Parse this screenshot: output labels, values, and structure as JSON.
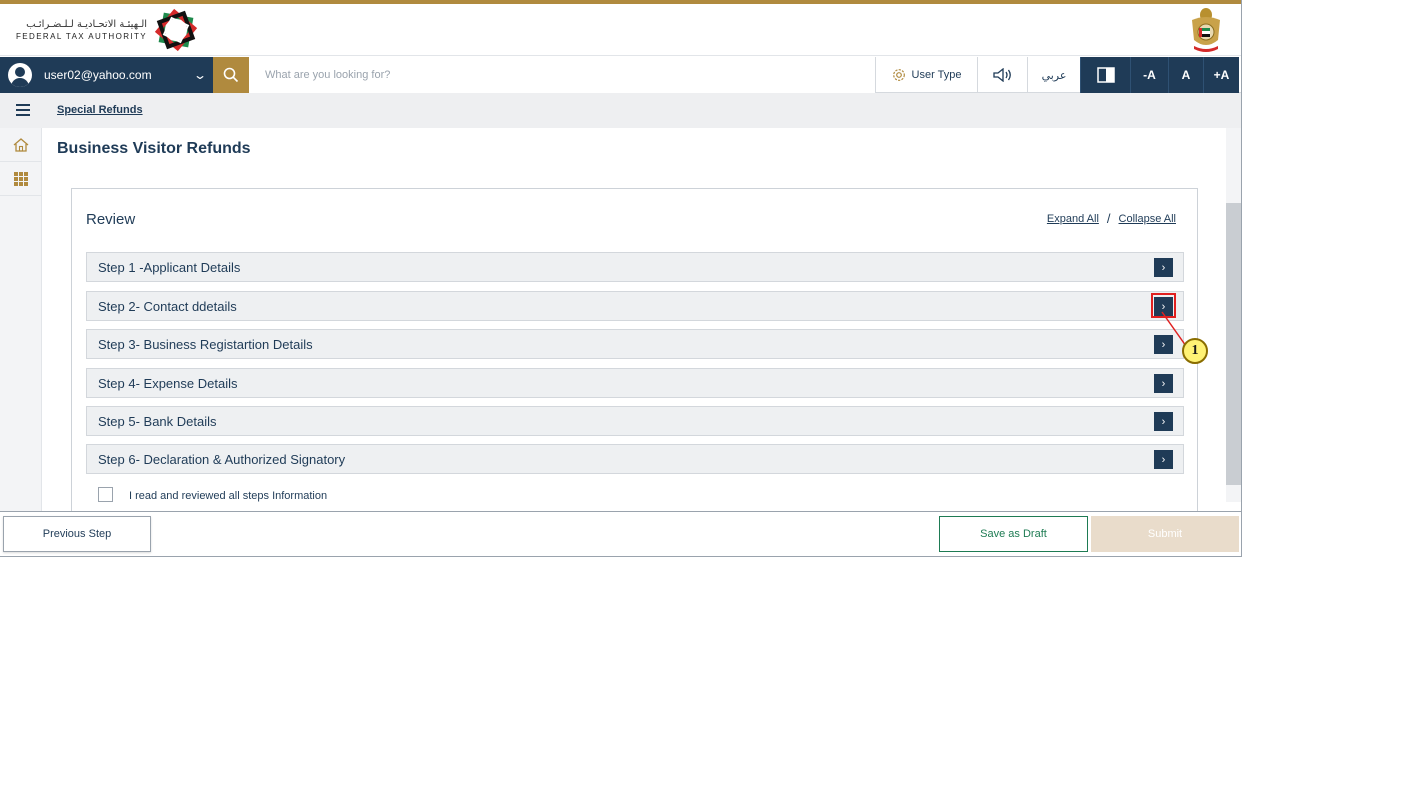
{
  "header": {
    "logo_arabic": "الـهيئـة الاتحـاديـة لـلـضـرائـب",
    "logo_english": "FEDERAL TAX AUTHORITY",
    "emblem_icon": "uae-emblem-icon",
    "accent_color": "#b08a3e",
    "primary_color": "#1f3b57"
  },
  "nav": {
    "user_email": "user02@yahoo.com",
    "search_placeholder": "What are you looking for?",
    "user_type_label": "User Type",
    "arabic_label": "عربي",
    "font_decrease": "-A",
    "font_normal": "A",
    "font_increase": "+A"
  },
  "breadcrumb": {
    "item": "Special Refunds"
  },
  "page": {
    "title": "Business Visitor Refunds"
  },
  "review": {
    "title": "Review",
    "expand_all": "Expand All",
    "separator": "/",
    "collapse_all": "Collapse All",
    "steps": [
      {
        "label": "Step 1 -Applicant Details"
      },
      {
        "label": "Step 2- Contact ddetails"
      },
      {
        "label": "Step 3- Business Registartion Details"
      },
      {
        "label": "Step 4- Expense Details"
      },
      {
        "label": "Step 5- Bank Details"
      },
      {
        "label": "Step 6- Declaration & Authorized Signatory"
      }
    ],
    "confirm_label": "I read and reviewed all steps Information",
    "confirm_checked": false
  },
  "footer": {
    "previous": "Previous Step",
    "save_draft": "Save as Draft",
    "submit": "Submit"
  },
  "annotation": {
    "number": "1"
  }
}
